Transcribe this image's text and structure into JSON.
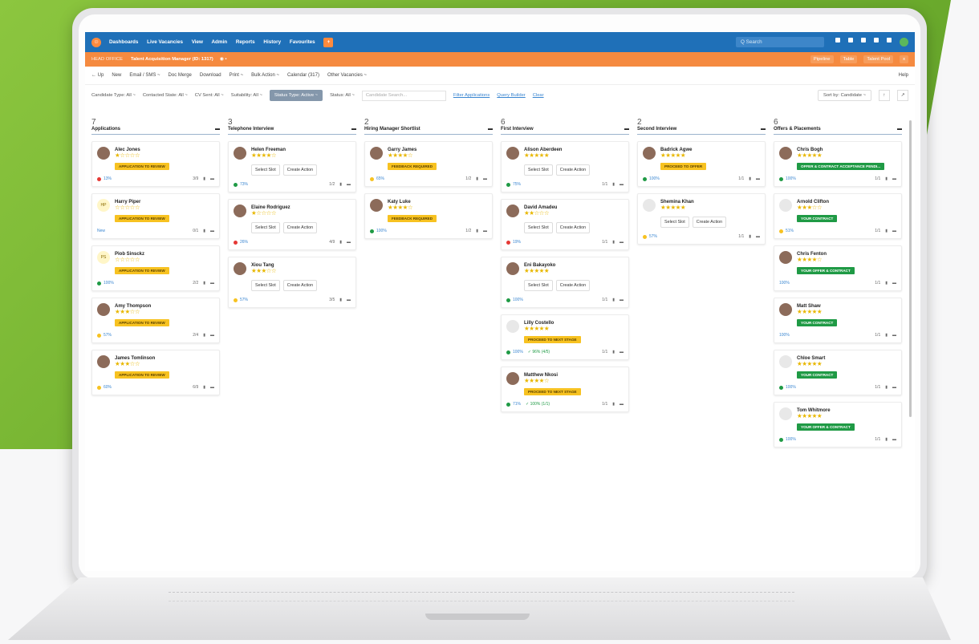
{
  "nav": {
    "logo": "☺",
    "items": [
      "Dashboards",
      "Live Vacancies",
      "View",
      "Admin",
      "Reports",
      "History",
      "Favourites"
    ],
    "plus": "+",
    "search_placeholder": "Q Search"
  },
  "jobbar": {
    "office": "HEAD OFFICE",
    "job_title": "Talent Acquisition Manager (ID: 1317)",
    "buttons": [
      "Pipeline",
      "Table",
      "Talent Pool",
      "x"
    ]
  },
  "toolbar": {
    "items": [
      "← Up",
      "New",
      "Email / SMS ~",
      "Doc Merge",
      "Download",
      "Print ~",
      "Bulk Action ~",
      "Calendar (317)",
      "Other Vacancies ~"
    ],
    "help": "Help"
  },
  "filters": {
    "items": [
      "Candidate Type: All ~",
      "Contacted State: All ~",
      "CV Sent: All ~",
      "Suitability: All ~"
    ],
    "active": "Status Type: Active ~",
    "status": "Status: All ~",
    "search_placeholder": "Candidate Search...",
    "links": [
      "Filter Applications",
      "Query Builder",
      "Clear"
    ],
    "sort": "Sort by: Candidate ~"
  },
  "columns": [
    {
      "count": "7",
      "title": "Applications",
      "cards": [
        {
          "name": "Alec Jones",
          "stars": "★☆☆☆☆",
          "badge": "APPLICATION TO REVIEW",
          "dot": "r",
          "pct": "13%",
          "meta": "3/9"
        },
        {
          "name": "Harry Piper",
          "initials": "HP",
          "stars": "☆☆☆☆☆",
          "badge": "APPLICATION TO REVIEW",
          "dot": "",
          "pct": "New",
          "meta": "0/1"
        },
        {
          "name": "Piob Sinsckz",
          "initials": "PS",
          "stars": "☆☆☆☆☆",
          "badge": "APPLICATION TO REVIEW",
          "dot": "g",
          "pct": "100%",
          "meta": "2/2"
        },
        {
          "name": "Amy Thompson",
          "stars": "★★★☆☆",
          "badge": "APPLICATION TO REVIEW",
          "dot": "y",
          "pct": "57%",
          "meta": "2/4"
        },
        {
          "name": "James Tomlinson",
          "stars": "★★★☆☆",
          "badge": "APPLICATION TO REVIEW",
          "dot": "y",
          "pct": "60%",
          "meta": "6/9"
        }
      ]
    },
    {
      "count": "3",
      "title": "Telephone Interview",
      "cards": [
        {
          "name": "Helen Freeman",
          "stars": "★★★★☆",
          "dot": "g",
          "pct": "73%",
          "meta": "1/2",
          "slot": true
        },
        {
          "name": "Elaine Rodriguez",
          "stars": "★☆☆☆☆",
          "dot": "r",
          "pct": "26%",
          "meta": "4/9",
          "slot": true
        },
        {
          "name": "Xiou Tang",
          "stars": "★★★☆☆",
          "dot": "y",
          "pct": "57%",
          "meta": "3/5",
          "slot": true
        }
      ]
    },
    {
      "count": "2",
      "title": "Hiring Manager Shortlist",
      "cards": [
        {
          "name": "Garry James",
          "stars": "★★★★☆",
          "badge": "FEEDBACK REQUIRED",
          "dot": "y",
          "pct": "65%",
          "meta": "1/2"
        },
        {
          "name": "Katy Luke",
          "stars": "★★★★☆",
          "badge": "FEEDBACK REQUIRED",
          "dot": "g",
          "pct": "100%",
          "meta": "1/2"
        }
      ]
    },
    {
      "count": "6",
      "title": "First Interview",
      "cards": [
        {
          "name": "Alison Aberdeen",
          "stars": "★★★★★",
          "dot": "g",
          "pct": "75%",
          "meta": "1/1",
          "slot": true
        },
        {
          "name": "David Amadeu",
          "stars": "★★☆☆☆",
          "dot": "r",
          "pct": "19%",
          "meta": "1/1",
          "slot": true
        },
        {
          "name": "Eni Bakayoko",
          "stars": "★★★★★",
          "dot": "g",
          "pct": "100%",
          "meta": "1/1",
          "slot": true
        },
        {
          "name": "Lilly Costello",
          "stars": "★★★★★",
          "badge": "PROCEED TO NEXT STAGE",
          "dot": "g",
          "pct": "100%",
          "check": "✓ 96% (4/5)",
          "meta": "1/1",
          "blank": true
        },
        {
          "name": "Matthew Nkosi",
          "stars": "★★★★☆",
          "badge": "PROCEED TO NEXT STAGE",
          "dot": "g",
          "pct": "71%",
          "check": "✓ 100% (1/1)",
          "meta": "1/1"
        }
      ]
    },
    {
      "count": "2",
      "title": "Second Interview",
      "cards": [
        {
          "name": "Badrick Agwe",
          "stars": "★★★★★",
          "badge": "PROCEED TO OFFER",
          "dot": "g",
          "pct": "100%",
          "meta": "1/1"
        },
        {
          "name": "Shemina Khan",
          "stars": "★★★★★",
          "dot": "y",
          "pct": "57%",
          "meta": "1/1",
          "slot": true,
          "blank": true
        }
      ]
    },
    {
      "count": "6",
      "title": "Offers & Placements",
      "cards": [
        {
          "name": "Chris Bogh",
          "stars": "★★★★★",
          "badge": "OFFER & CONTRACT ACCEPTANCE PENDI...",
          "green": true,
          "dot": "g",
          "pct": "100%",
          "meta": "1/1"
        },
        {
          "name": "Arnold Clifton",
          "stars": "★★★☆☆",
          "badge": "YOUR CONTRACT",
          "green": true,
          "dot": "y",
          "pct": "51%",
          "meta": "1/1",
          "blank": true
        },
        {
          "name": "Chris Fenton",
          "stars": "★★★★☆",
          "badge": "YOUR OFFER & CONTRACT",
          "green": true,
          "dot": "",
          "pct": "100%",
          "meta": "1/1"
        },
        {
          "name": "Matt Shaw",
          "stars": "★★★★★",
          "badge": "YOUR CONTRACT",
          "green": true,
          "dot": "",
          "pct": "100%",
          "meta": "1/1"
        },
        {
          "name": "Chloe Smart",
          "stars": "★★★★★",
          "badge": "YOUR CONTRACT",
          "green": true,
          "dot": "g",
          "pct": "100%",
          "meta": "1/1",
          "blank": true
        },
        {
          "name": "Tom Whitmore",
          "stars": "★★★★★",
          "badge": "YOUR OFFER & CONTRACT",
          "green": true,
          "dot": "g",
          "pct": "100%",
          "meta": "1/1",
          "blank": true
        }
      ]
    }
  ],
  "card_buttons": [
    "Select Slot",
    "Create Action"
  ]
}
